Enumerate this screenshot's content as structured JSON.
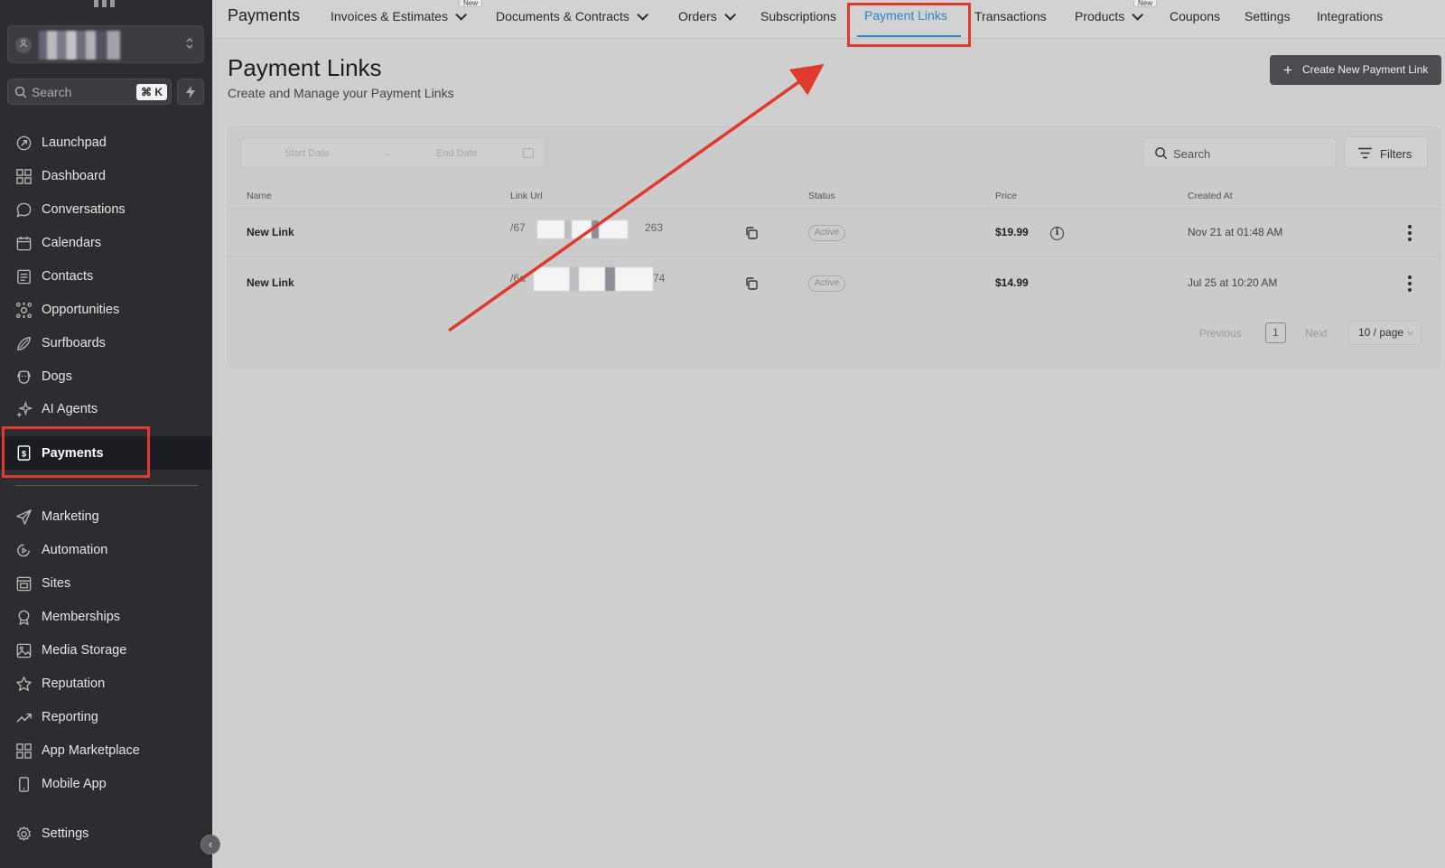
{
  "app": {
    "account_caret": "⌃⌄"
  },
  "sidebar": {
    "search_placeholder": "Search",
    "search_shortcut": "⌘ K",
    "items": [
      {
        "label": "Launchpad",
        "icon": "launchpad-icon"
      },
      {
        "label": "Dashboard",
        "icon": "dashboard-icon"
      },
      {
        "label": "Conversations",
        "icon": "chat-bubble-icon"
      },
      {
        "label": "Calendars",
        "icon": "calendar-icon"
      },
      {
        "label": "Contacts",
        "icon": "contacts-icon"
      },
      {
        "label": "Opportunities",
        "icon": "opportunities-icon"
      },
      {
        "label": "Surfboards",
        "icon": "surfboard-icon"
      },
      {
        "label": "Dogs",
        "icon": "dog-icon"
      },
      {
        "label": "AI Agents",
        "icon": "sparkle-icon"
      },
      {
        "label": "Payments",
        "icon": "payments-icon",
        "active": true
      }
    ],
    "items_secondary": [
      {
        "label": "Marketing",
        "icon": "send-icon"
      },
      {
        "label": "Automation",
        "icon": "automation-icon"
      },
      {
        "label": "Sites",
        "icon": "sites-icon"
      },
      {
        "label": "Memberships",
        "icon": "badge-icon"
      },
      {
        "label": "Media Storage",
        "icon": "image-icon"
      },
      {
        "label": "Reputation",
        "icon": "star-icon"
      },
      {
        "label": "Reporting",
        "icon": "trend-icon"
      },
      {
        "label": "App Marketplace",
        "icon": "grid-icon"
      },
      {
        "label": "Mobile App",
        "icon": "phone-icon"
      }
    ],
    "settings_label": "Settings",
    "collapse_glyph": "‹"
  },
  "topnav": {
    "title": "Payments",
    "tabs": [
      {
        "label": "Invoices & Estimates",
        "dropdown": true,
        "badge": "New"
      },
      {
        "label": "Documents & Contracts",
        "dropdown": true
      },
      {
        "label": "Orders",
        "dropdown": true
      },
      {
        "label": "Subscriptions"
      },
      {
        "label": "Payment Links",
        "active": true
      },
      {
        "label": "Transactions"
      },
      {
        "label": "Products",
        "dropdown": true,
        "badge": "New"
      },
      {
        "label": "Coupons"
      },
      {
        "label": "Settings"
      },
      {
        "label": "Integrations"
      }
    ],
    "active_color": "#2a87c3"
  },
  "page": {
    "title": "Payment Links",
    "subtitle": "Create and Manage your Payment Links",
    "create_button": "Create New Payment Link",
    "create_plus": "+"
  },
  "filters": {
    "start_date_placeholder": "Start Date",
    "end_date_placeholder": "End Date",
    "arrow": "→",
    "search_placeholder": "Search",
    "filters_label": "Filters"
  },
  "table": {
    "columns": [
      "Name",
      "Link Url",
      "Status",
      "Price",
      "Created At"
    ],
    "rows": [
      {
        "name": "New Link",
        "url_start": "/67",
        "url_end": "263",
        "status": "Active",
        "price": "$19.99",
        "created_at": "Nov 21 at 01:48 AM",
        "info": "i"
      },
      {
        "name": "New Link",
        "url_start": "/6a",
        "url_end": "74",
        "status": "Active",
        "price": "$14.99",
        "created_at": "Jul 25 at 10:20 AM"
      }
    ]
  },
  "pagination": {
    "previous": "Previous",
    "page": "1",
    "next": "Next",
    "per_page": "10 / page"
  },
  "annotation_color": "#e03a2e"
}
